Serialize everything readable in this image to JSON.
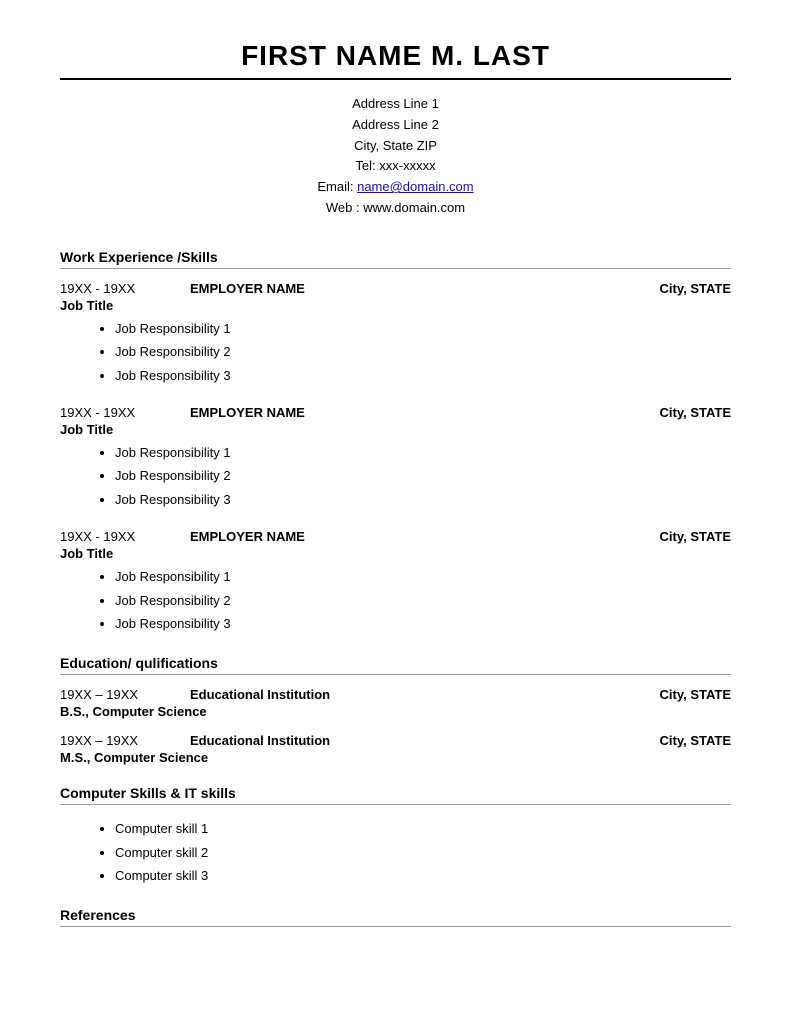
{
  "header": {
    "name": "FIRST NAME M. LAST"
  },
  "contact": {
    "address1": "Address Line 1",
    "address2": "Address Line 2",
    "city_state_zip": "City, State ZIP",
    "tel_label": "Tel: xxx-xxxxx",
    "email_label": "Email: ",
    "email_link_text": "name@domain.com",
    "email_href": "mailto:name@domain.com",
    "web": "Web : www.domain.com"
  },
  "work_section": {
    "title": "Work Experience /Skills",
    "jobs": [
      {
        "dates": "19XX - 19XX",
        "employer": "EMPLOYER NAME",
        "location": "City, STATE",
        "title": "Job Title",
        "responsibilities": [
          "Job Responsibility 1",
          "Job Responsibility 2",
          "Job Responsibility 3"
        ]
      },
      {
        "dates": "19XX - 19XX",
        "employer": "EMPLOYER NAME",
        "location": "City, STATE",
        "title": "Job Title",
        "responsibilities": [
          "Job Responsibility 1",
          "Job Responsibility 2",
          "Job Responsibility 3"
        ]
      },
      {
        "dates": "19XX - 19XX",
        "employer": "EMPLOYER NAME",
        "location": "City, STATE",
        "title": "Job Title",
        "responsibilities": [
          "Job Responsibility 1",
          "Job Responsibility 2",
          "Job Responsibility 3"
        ]
      }
    ]
  },
  "education_section": {
    "title": "Education/ qulifications",
    "entries": [
      {
        "dates": "19XX – 19XX",
        "institution": "Educational Institution",
        "location": "City, STATE",
        "degree": "B.S., Computer Science"
      },
      {
        "dates": "19XX – 19XX",
        "institution": "Educational Institution",
        "location": "City, STATE",
        "degree": "M.S., Computer Science"
      }
    ]
  },
  "computer_skills_section": {
    "title": "Computer Skills & IT skills",
    "skills": [
      "Computer skill 1",
      "Computer skill 2",
      "Computer skill 3"
    ]
  },
  "references_section": {
    "title": "References"
  }
}
